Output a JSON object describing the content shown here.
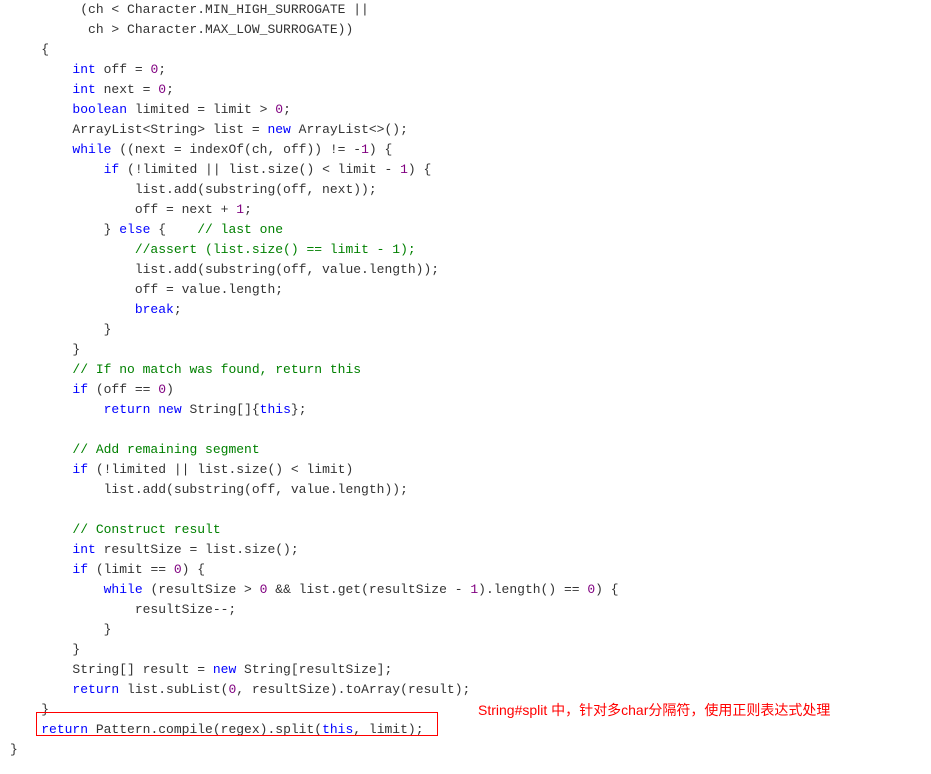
{
  "code": {
    "l1a": "         (ch < Character.MIN_HIGH_SURROGATE ||",
    "l1b": "          ch > Character.MAX_LOW_SURROGATE))",
    "l2": "    {",
    "l3_indent": "        ",
    "l3_kw": "int",
    "l3_rest": " off = ",
    "l3_num": "0",
    "l3_end": ";",
    "l4_indent": "        ",
    "l4_kw": "int",
    "l4_rest": " next = ",
    "l4_num": "0",
    "l4_end": ";",
    "l5_indent": "        ",
    "l5_kw": "boolean",
    "l5_rest": " limited = limit > ",
    "l5_num": "0",
    "l5_end": ";",
    "l6_indent": "        ArrayList<String> list = ",
    "l6_kw": "new",
    "l6_rest": " ArrayList<>();",
    "l7_indent": "        ",
    "l7_kw": "while",
    "l7_rest": " ((next = indexOf(ch, off)) != -",
    "l7_num": "1",
    "l7_end": ") {",
    "l8_indent": "            ",
    "l8_kw": "if",
    "l8_rest": " (!limited || list.size() < limit - ",
    "l8_num": "1",
    "l8_end": ") {",
    "l9": "                list.add(substring(off, next));",
    "l10_indent": "                off = next + ",
    "l10_num": "1",
    "l10_end": ";",
    "l11_indent": "            } ",
    "l11_kw": "else",
    "l11_rest": " {    ",
    "l11_cmt": "// last one",
    "l12_indent": "                ",
    "l12_cmt": "//assert (list.size() == limit - 1);",
    "l13": "                list.add(substring(off, value.length));",
    "l14": "                off = value.length;",
    "l15_indent": "                ",
    "l15_kw": "break",
    "l15_end": ";",
    "l16": "            }",
    "l17": "        }",
    "l18_indent": "        ",
    "l18_cmt": "// If no match was found, return this",
    "l19_indent": "        ",
    "l19_kw": "if",
    "l19_rest": " (off == ",
    "l19_num": "0",
    "l19_end": ")",
    "l20_indent": "            ",
    "l20_kw1": "return",
    "l20_sp": " ",
    "l20_kw2": "new",
    "l20_rest": " String[]{",
    "l20_kw3": "this",
    "l20_end": "};",
    "l21": "",
    "l22_indent": "        ",
    "l22_cmt": "// Add remaining segment",
    "l23_indent": "        ",
    "l23_kw": "if",
    "l23_rest": " (!limited || list.size() < limit)",
    "l24": "            list.add(substring(off, value.length));",
    "l25": "",
    "l26_indent": "        ",
    "l26_cmt": "// Construct result",
    "l27_indent": "        ",
    "l27_kw": "int",
    "l27_rest": " resultSize = list.size();",
    "l28_indent": "        ",
    "l28_kw": "if",
    "l28_rest": " (limit == ",
    "l28_num": "0",
    "l28_end": ") {",
    "l29_indent": "            ",
    "l29_kw": "while",
    "l29_rest": " (resultSize > ",
    "l29_num1": "0",
    "l29_mid": " && list.get(resultSize - ",
    "l29_num2": "1",
    "l29_mid2": ").length() == ",
    "l29_num3": "0",
    "l29_end": ") {",
    "l30": "                resultSize--;",
    "l31": "            }",
    "l32": "        }",
    "l33_indent": "        String[] result = ",
    "l33_kw": "new",
    "l33_rest": " String[resultSize];",
    "l34_indent": "        ",
    "l34_kw": "return",
    "l34_rest": " list.subList(",
    "l34_num": "0",
    "l34_end": ", resultSize).toArray(result);",
    "l35": "    }",
    "l36_indent": "    ",
    "l36_kw": "return",
    "l36_rest": " Pattern.compile(regex).split(",
    "l36_kw2": "this",
    "l36_end": ", limit);",
    "l37": "}"
  },
  "annotation": "String#split 中，针对多char分隔符，使用正则表达式处理"
}
